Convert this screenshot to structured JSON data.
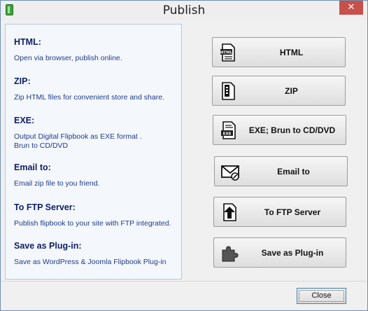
{
  "window": {
    "title": "Publish",
    "close_glyph": "✕"
  },
  "sections": [
    {
      "title": "HTML:",
      "desc": "Open via browser, publish online."
    },
    {
      "title": "ZIP:",
      "desc": "Zip HTML files for convenient store and share."
    },
    {
      "title": "EXE:",
      "desc": "Output Digital Flipbook as EXE format .\nBrun to CD/DVD"
    },
    {
      "title": "Email to:",
      "desc": "Email zip file to you friend."
    },
    {
      "title": "To FTP Server:",
      "desc": "Publish flipbook to your site with FTP integrated."
    },
    {
      "title": "Save as Plug-in:",
      "desc": "Save as WordPress & Joomla Flipbook Plug-in"
    }
  ],
  "buttons": [
    {
      "label": "HTML",
      "icon": "html-document-icon",
      "icon_text": "HTML"
    },
    {
      "label": "ZIP",
      "icon": "zip-document-icon"
    },
    {
      "label": "EXE; Brun to CD/DVD",
      "icon": "exe-document-icon",
      "icon_text": "EXE"
    },
    {
      "label": "Email to",
      "icon": "email-envelope-icon"
    },
    {
      "label": "To FTP Server",
      "icon": "ftp-upload-icon"
    },
    {
      "label": "Save as Plug-in",
      "icon": "puzzle-plugin-icon"
    }
  ],
  "footer": {
    "close_label": "Close"
  }
}
